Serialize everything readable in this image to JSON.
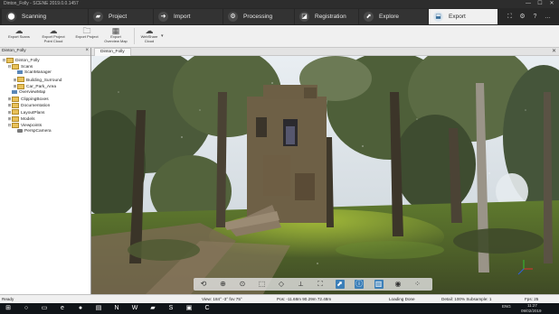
{
  "window": {
    "title": "Dinton_Folly - SCENE 2019.0.0.1457",
    "controls": [
      "—",
      "☐",
      "✕"
    ]
  },
  "tabs": [
    {
      "label": "Scanning",
      "icon": "scanner-icon",
      "glyph": "⬤"
    },
    {
      "label": "Project",
      "icon": "folder-icon",
      "glyph": "▰"
    },
    {
      "label": "Import",
      "icon": "import-icon",
      "glyph": "➜"
    },
    {
      "label": "Processing",
      "icon": "processing-icon",
      "glyph": "⚙"
    },
    {
      "label": "Registration",
      "icon": "registration-icon",
      "glyph": "◪"
    },
    {
      "label": "Explore",
      "icon": "explore-icon",
      "glyph": "⬈"
    },
    {
      "label": "Export",
      "icon": "export-icon",
      "glyph": "⬓",
      "active": true
    }
  ],
  "tab_buttons": [
    "⛶",
    "⚙",
    "?",
    "…"
  ],
  "ribbon": {
    "buttons": [
      {
        "line1": "Export Scans",
        "line2": "",
        "glyph": "☁"
      },
      {
        "line1": "Export Project",
        "line2": "Point Cloud",
        "glyph": "☁"
      },
      {
        "line1": "Export Project",
        "line2": "",
        "glyph": "🗀"
      },
      {
        "line1": "Export",
        "line2": "Overview Map",
        "glyph": "▦"
      },
      {
        "line1": "WebShare",
        "line2": "Cloud",
        "glyph": "☁"
      }
    ]
  },
  "structure_panel": {
    "title": "Dinton_Folly",
    "items": [
      {
        "label": "Dinton_Folly",
        "depth": 0,
        "toggle": "⊟",
        "icon": "fold"
      },
      {
        "label": "Scans",
        "depth": 1,
        "toggle": "⊟",
        "icon": "fold"
      },
      {
        "label": "ScanManager",
        "depth": 2,
        "toggle": "",
        "icon": "scn"
      },
      {
        "label": "Building_Surround",
        "depth": 2,
        "toggle": "⊞",
        "icon": "fold"
      },
      {
        "label": "Car_Park_Area",
        "depth": 2,
        "toggle": "⊞",
        "icon": "fold"
      },
      {
        "label": "OverviewMap",
        "depth": 1,
        "toggle": "",
        "icon": "scn"
      },
      {
        "label": "ClippingBoxes",
        "depth": 1,
        "toggle": "⊞",
        "icon": "fold"
      },
      {
        "label": "Documentation",
        "depth": 1,
        "toggle": "⊞",
        "icon": "fold"
      },
      {
        "label": "LayoutPlans",
        "depth": 1,
        "toggle": "⊞",
        "icon": "fold"
      },
      {
        "label": "Models",
        "depth": 1,
        "toggle": "⊞",
        "icon": "fold"
      },
      {
        "label": "Viewpoints",
        "depth": 1,
        "toggle": "⊟",
        "icon": "fold"
      },
      {
        "label": "PerspCamera",
        "depth": 2,
        "toggle": "",
        "icon": "cam"
      }
    ]
  },
  "viewer": {
    "tab_label": "Dinton_Folly",
    "close": "✕",
    "toolbar": [
      {
        "name": "orbit-icon",
        "glyph": "⟲"
      },
      {
        "name": "zoom-icon",
        "glyph": "⊕"
      },
      {
        "name": "zoom-extent-icon",
        "glyph": "⊙"
      },
      {
        "name": "box-icon",
        "glyph": "⬚"
      },
      {
        "name": "view-icon",
        "glyph": "◇"
      },
      {
        "name": "measure-icon",
        "glyph": "⟂"
      },
      {
        "name": "clip-icon",
        "glyph": "⛶"
      },
      {
        "name": "select-icon",
        "glyph": "⬈",
        "selected": true
      },
      {
        "name": "info-icon",
        "glyph": "ⓘ",
        "selected": true
      },
      {
        "name": "layers-icon",
        "glyph": "▥",
        "selected": true
      },
      {
        "name": "render-icon",
        "glyph": "◉"
      },
      {
        "name": "grid-icon",
        "glyph": "⁘"
      }
    ]
  },
  "status": {
    "left": "Ready",
    "view": "View: 184° -3° fov 75°",
    "pos": "Pos: -11.68m 90.29m 72.48m",
    "loading": "Loading Done",
    "detail": "Detail: 100%  Subsample: 1",
    "fps": "Fps: 25"
  },
  "taskbar": {
    "apps": [
      "⊞",
      "○",
      "▭",
      "e",
      "●",
      "▤",
      "N",
      "W",
      "▰",
      "S",
      "▣",
      "C"
    ],
    "right": "ENG",
    "time": "11:27",
    "date": "09/02/2019"
  },
  "colors": {
    "accent": "#3c7fb8",
    "tabbar": "#272727",
    "ribbon": "#f0f0f0"
  }
}
